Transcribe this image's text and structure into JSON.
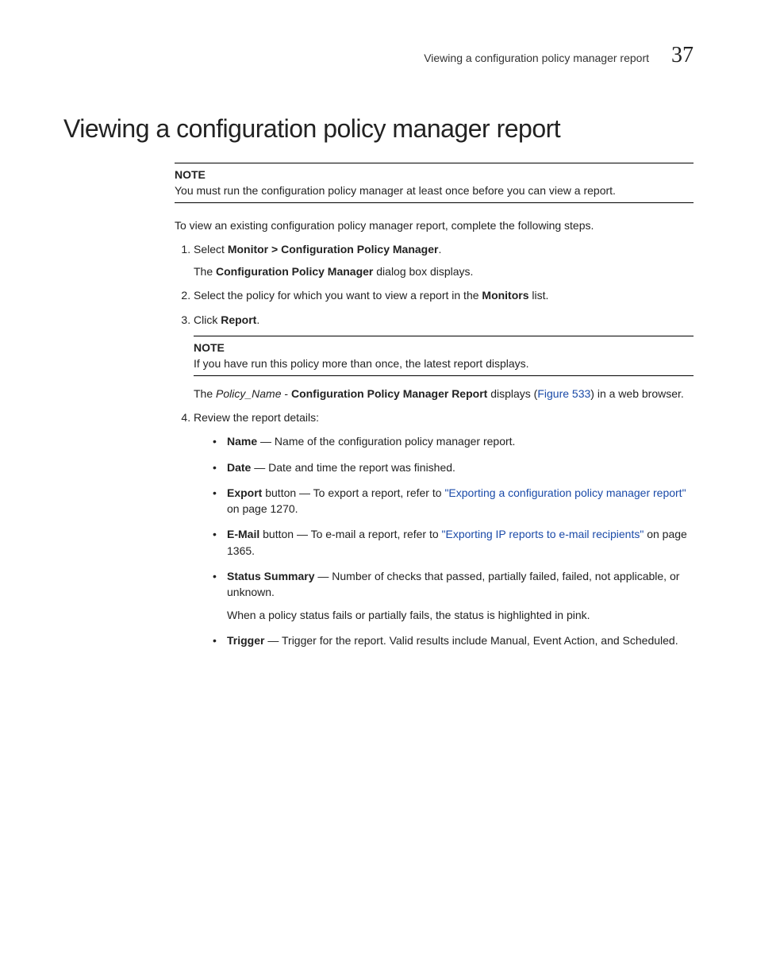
{
  "header": {
    "running_title": "Viewing a configuration policy manager report",
    "chapter_number": "37"
  },
  "title": "Viewing a configuration policy manager report",
  "note1": {
    "label": "NOTE",
    "text": "You must run the configuration policy manager at least once before you can view a report."
  },
  "intro": "To view an existing configuration policy manager report, complete the following steps.",
  "step1": {
    "prefix": "Select ",
    "bold": "Monitor > Configuration Policy Manager",
    "suffix": ".",
    "sub_prefix": "The ",
    "sub_bold": "Configuration Policy Manager",
    "sub_suffix": " dialog box displays."
  },
  "step2": {
    "prefix": "Select the policy for which you want to view a report in the ",
    "bold": "Monitors",
    "suffix": " list."
  },
  "step3": {
    "prefix": "Click ",
    "bold": "Report",
    "suffix": ".",
    "note_label": "NOTE",
    "note_text": "If you have run this policy more than once, the latest report displays.",
    "after1_prefix": "The ",
    "after1_italic": "Policy_Name",
    "after1_mid": " - ",
    "after1_bold": "Configuration Policy Manager Report",
    "after1_mid2": " displays (",
    "after1_link": "Figure 533",
    "after1_suffix": ") in a web browser."
  },
  "step4": {
    "text": "Review the report details:",
    "bullets": {
      "name": {
        "bold": "Name",
        "rest": " — Name of the configuration policy manager report."
      },
      "date": {
        "bold": "Date",
        "rest": " — Date and time the report was finished."
      },
      "export": {
        "bold": "Export",
        "mid": " button — To export a report, refer to ",
        "link": "\"Exporting a configuration policy manager report\"",
        "tail": " on page 1270."
      },
      "email": {
        "bold": "E-Mail",
        "mid": " button — To e-mail a report, refer to ",
        "link": "\"Exporting IP reports to e-mail recipients\"",
        "tail": " on page 1365."
      },
      "status": {
        "bold": "Status Summary",
        "rest": " — Number of checks that passed, partially failed, failed, not applicable, or unknown.",
        "extra": "When a policy status fails or partially fails, the status is highlighted in pink."
      },
      "trigger": {
        "bold": "Trigger",
        "rest": " — Trigger for the report. Valid results include Manual, Event Action, and Scheduled."
      }
    }
  }
}
